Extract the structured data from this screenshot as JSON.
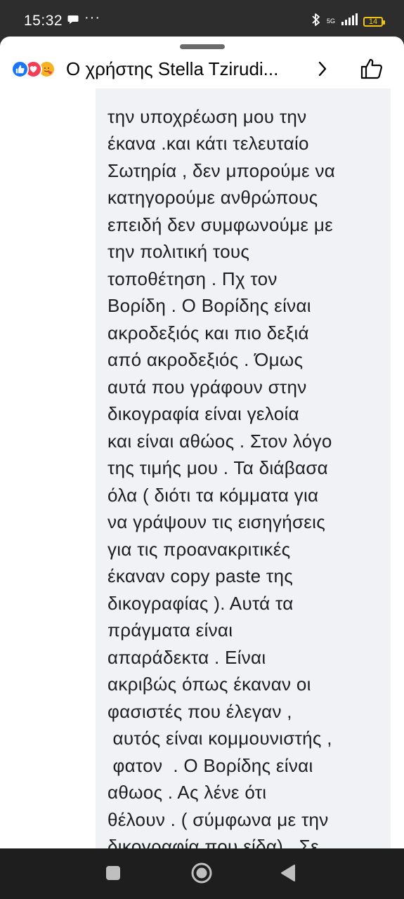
{
  "status_bar": {
    "time": "15:32",
    "dots": "···",
    "network": "5G",
    "battery": "14"
  },
  "header": {
    "title": "Ο χρήστης Stella Tzirudi...",
    "reactions": [
      "like-icon",
      "love-icon",
      "care-icon"
    ]
  },
  "comment": {
    "lines": [
      "την υποχρέωση μου την",
      "έκανα .και κάτι τελευταίο",
      "Σωτηρία , δεν μπορούμε να",
      "κατηγορούμε ανθρώπους",
      "επειδή δεν συμφωνούμε με",
      "την πολιτική τους",
      "τοποθέτηση . Πχ τον",
      "Βορίδη . Ο Βορίδης είναι",
      "ακροδεξιός και πιο δεξιά",
      "από ακροδεξιός . Όμως",
      "αυτά που γράφουν στην",
      "δικογραφία είναι γελοία",
      "και είναι αθώος . Στον λόγο",
      "της τιμής μου . Τα διάβασα",
      "όλα ( διότι τα κόμματα για",
      "να γράψουν τις εισηγήσεις",
      "για τις προανακριτικές",
      "έκαναν copy paste της",
      "δικογραφίας ). Αυτά τα",
      "πράγματα είναι",
      "απαράδεκτα . Είναι",
      "ακριβώς όπως έκαναν οι",
      "φασιστές που έλεγαν ,",
      " αυτός είναι κομμουνιστής ,",
      " φατον  . Ο Βορίδης είναι",
      "αθωος . Ας λένε ότι",
      "θέλουν . ( σύμφωνα με την",
      "δικογραφία που είδα) . Σε"
    ]
  },
  "colors": {
    "status_bg": "#2d2d2d",
    "sheet_bg": "#ffffff",
    "bubble_bg": "#f0f2f5",
    "text": "#1c1e21",
    "like": "#1877f2",
    "love": "#f33e58",
    "care": "#f7b125",
    "battery": "#f1c40f",
    "nav_bg": "#1e1e1e"
  },
  "nav": {
    "buttons": [
      "recent-apps-icon",
      "home-icon",
      "back-icon"
    ]
  }
}
